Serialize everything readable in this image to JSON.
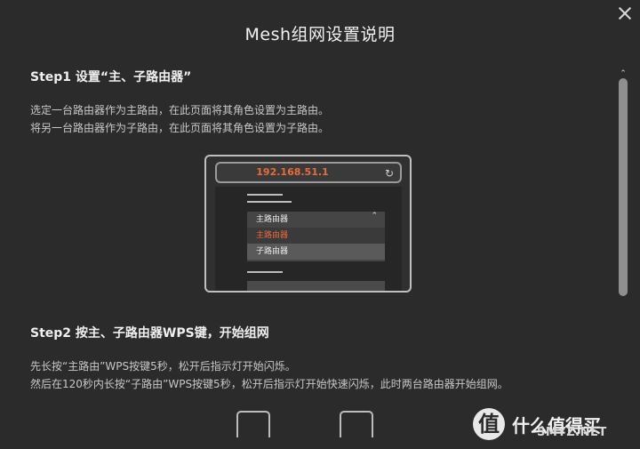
{
  "dialog": {
    "title": "Mesh组网设置说明"
  },
  "step1": {
    "title": "Step1 设置“主、子路由器”",
    "line1": "选定一台路由器作为主路由，在此页面将其角色设置为主路由。",
    "line2": "将另一台路由器作为子路由，在此页面将其角色设置为子路由。",
    "illustration": {
      "url": "192.168.51.1",
      "reload_icon": "refresh-icon",
      "dropdown_selected": "主路由器",
      "dropdown_options": [
        "主路由器",
        "子路由器"
      ],
      "accent": "#e86b3c"
    }
  },
  "step2": {
    "title": "Step2 按主、子路由器WPS键，开始组网",
    "line1": "先长按“主路由”WPS按键5秒，松开后指示灯开始闪烁。",
    "line2": "然后在120秒内长按“子路由”WPS按键5秒，松开后指示灯开始快速闪烁，此时两台路由器开始组网。"
  },
  "icons": {
    "close": "close-icon",
    "scroll_up": "chevron-up-icon"
  },
  "watermark": {
    "logo_char": "值",
    "text": "什么值得买",
    "sub": "SMYZ.NET"
  }
}
